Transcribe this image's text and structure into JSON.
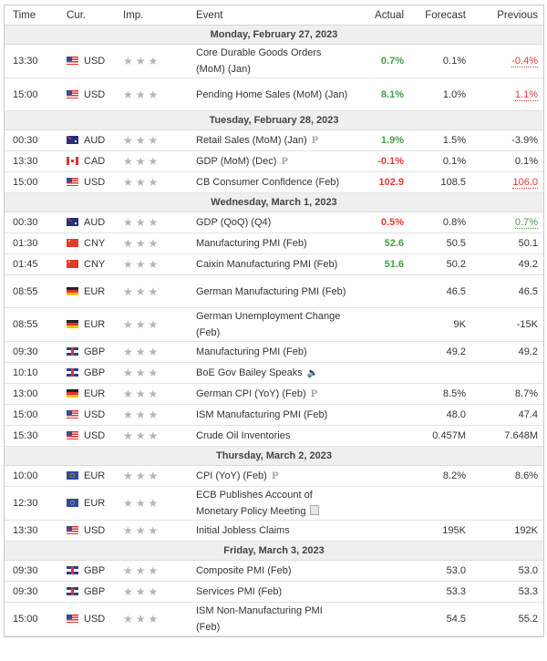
{
  "columns": {
    "time": "Time",
    "currency": "Cur.",
    "importance": "Imp.",
    "event": "Event",
    "actual": "Actual",
    "forecast": "Forecast",
    "previous": "Previous"
  },
  "importance_icon": "★★★",
  "days": [
    {
      "label": "Monday, February 27, 2023",
      "rows": [
        {
          "time": "13:30",
          "flag": "us",
          "currency": "USD",
          "event": "Core Durable Goods Orders (MoM) (Jan)",
          "actual": "0.7%",
          "actual_color": "green",
          "forecast": "0.1%",
          "previous": "-0.4%",
          "previous_style": "dotted-red",
          "tall": true
        },
        {
          "time": "15:00",
          "flag": "us",
          "currency": "USD",
          "event": "Pending Home Sales (MoM) (Jan)",
          "actual": "8.1%",
          "actual_color": "green",
          "forecast": "1.0%",
          "previous": "1.1%",
          "previous_style": "dotted-red",
          "tall": true
        }
      ]
    },
    {
      "label": "Tuesday, February 28, 2023",
      "rows": [
        {
          "time": "00:30",
          "flag": "au",
          "currency": "AUD",
          "event": "Retail Sales (MoM) (Jan)",
          "event_icon": "preliminary-icon",
          "actual": "1.9%",
          "actual_color": "green",
          "forecast": "1.5%",
          "previous": "-3.9%"
        },
        {
          "time": "13:30",
          "flag": "ca",
          "currency": "CAD",
          "event": "GDP (MoM) (Dec)",
          "event_icon": "preliminary-icon",
          "actual": "-0.1%",
          "actual_color": "red",
          "forecast": "0.1%",
          "previous": "0.1%"
        },
        {
          "time": "15:00",
          "flag": "us",
          "currency": "USD",
          "event": "CB Consumer Confidence (Feb)",
          "actual": "102.9",
          "actual_color": "red",
          "forecast": "108.5",
          "previous": "106.0",
          "previous_style": "dotted-red"
        }
      ]
    },
    {
      "label": "Wednesday, March 1, 2023",
      "rows": [
        {
          "time": "00:30",
          "flag": "au",
          "currency": "AUD",
          "event": "GDP (QoQ) (Q4)",
          "actual": "0.5%",
          "actual_color": "red",
          "forecast": "0.8%",
          "previous": "0.7%",
          "previous_style": "dotted-green"
        },
        {
          "time": "01:30",
          "flag": "cn",
          "currency": "CNY",
          "event": "Manufacturing PMI (Feb)",
          "actual": "52.6",
          "actual_color": "green",
          "forecast": "50.5",
          "previous": "50.1"
        },
        {
          "time": "01:45",
          "flag": "cn",
          "currency": "CNY",
          "event": "Caixin Manufacturing PMI (Feb)",
          "actual": "51.6",
          "actual_color": "green",
          "forecast": "50.2",
          "previous": "49.2"
        },
        {
          "time": "08:55",
          "flag": "de",
          "currency": "EUR",
          "event": "German Manufacturing PMI (Feb)",
          "actual": "",
          "forecast": "46.5",
          "previous": "46.5",
          "tall": true
        },
        {
          "time": "08:55",
          "flag": "de",
          "currency": "EUR",
          "event": "German Unemployment Change (Feb)",
          "actual": "",
          "forecast": "9K",
          "previous": "-15K",
          "tall": true
        },
        {
          "time": "09:30",
          "flag": "gb",
          "currency": "GBP",
          "event": "Manufacturing PMI (Feb)",
          "actual": "",
          "forecast": "49.2",
          "previous": "49.2"
        },
        {
          "time": "10:10",
          "flag": "gb",
          "currency": "GBP",
          "event": "BoE Gov Bailey Speaks",
          "event_icon": "speaker-icon",
          "actual": "",
          "forecast": "",
          "previous": ""
        },
        {
          "time": "13:00",
          "flag": "de",
          "currency": "EUR",
          "event": "German CPI (YoY) (Feb)",
          "event_icon": "preliminary-icon",
          "actual": "",
          "forecast": "8.5%",
          "previous": "8.7%"
        },
        {
          "time": "15:00",
          "flag": "us",
          "currency": "USD",
          "event": "ISM Manufacturing PMI (Feb)",
          "actual": "",
          "forecast": "48.0",
          "previous": "47.4"
        },
        {
          "time": "15:30",
          "flag": "us",
          "currency": "USD",
          "event": "Crude Oil Inventories",
          "actual": "",
          "forecast": "0.457M",
          "previous": "7.648M"
        }
      ]
    },
    {
      "label": "Thursday, March 2, 2023",
      "rows": [
        {
          "time": "10:00",
          "flag": "eu",
          "currency": "EUR",
          "event": "CPI (YoY) (Feb)",
          "event_icon": "preliminary-icon",
          "actual": "",
          "forecast": "8.2%",
          "previous": "8.6%"
        },
        {
          "time": "12:30",
          "flag": "eu",
          "currency": "EUR",
          "event": "ECB Publishes Account of Monetary Policy Meeting",
          "event_icon": "document-icon",
          "actual": "",
          "forecast": "",
          "previous": "",
          "tall": true
        },
        {
          "time": "13:30",
          "flag": "us",
          "currency": "USD",
          "event": "Initial Jobless Claims",
          "actual": "",
          "forecast": "195K",
          "previous": "192K"
        }
      ]
    },
    {
      "label": "Friday, March 3, 2023",
      "rows": [
        {
          "time": "09:30",
          "flag": "gb",
          "currency": "GBP",
          "event": "Composite PMI (Feb)",
          "actual": "",
          "forecast": "53.0",
          "previous": "53.0"
        },
        {
          "time": "09:30",
          "flag": "gb",
          "currency": "GBP",
          "event": "Services PMI (Feb)",
          "actual": "",
          "forecast": "53.3",
          "previous": "53.3"
        },
        {
          "time": "15:00",
          "flag": "us",
          "currency": "USD",
          "event": "ISM Non-Manufacturing PMI (Feb)",
          "actual": "",
          "forecast": "54.5",
          "previous": "55.2",
          "tall": true
        }
      ]
    }
  ]
}
